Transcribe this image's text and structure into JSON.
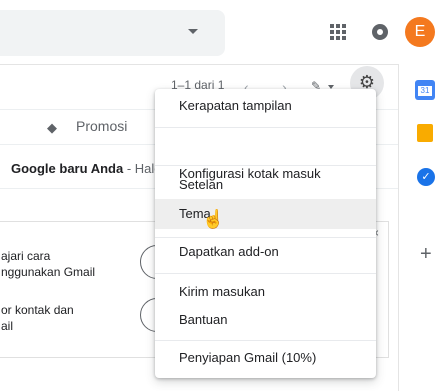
{
  "header": {
    "avatar_letter": "E",
    "avatar_color": "#f4791f"
  },
  "toolbar": {
    "pager_text": "1–1 dari 1",
    "prev_glyph": "‹",
    "next_glyph": "›",
    "pencil_glyph": "✎"
  },
  "tabs": {
    "promosi_label": "Promosi"
  },
  "email": {
    "subject": "Google baru Anda",
    "snippet": " - Halo E"
  },
  "tips": {
    "tip1_line1": "ajari cara",
    "tip1_line2": "nggunakan Gmail",
    "tip2_line1": "or kontak dan",
    "tip2_line2": "ail",
    "close_glyph": "×"
  },
  "rail": {
    "calendar_day": "31",
    "add_glyph": "+"
  },
  "settings_menu": {
    "items": [
      {
        "label": "Kerapatan tampilan"
      },
      {
        "label": "Konfigurasi kotak masuk"
      },
      {
        "label": "Setelan"
      },
      {
        "label": "Tema"
      },
      {
        "label": "Dapatkan add-on"
      },
      {
        "label": "Kirim masukan"
      },
      {
        "label": "Bantuan"
      },
      {
        "label": "Penyiapan Gmail (10%)"
      }
    ],
    "hovered_item": "Tema"
  }
}
